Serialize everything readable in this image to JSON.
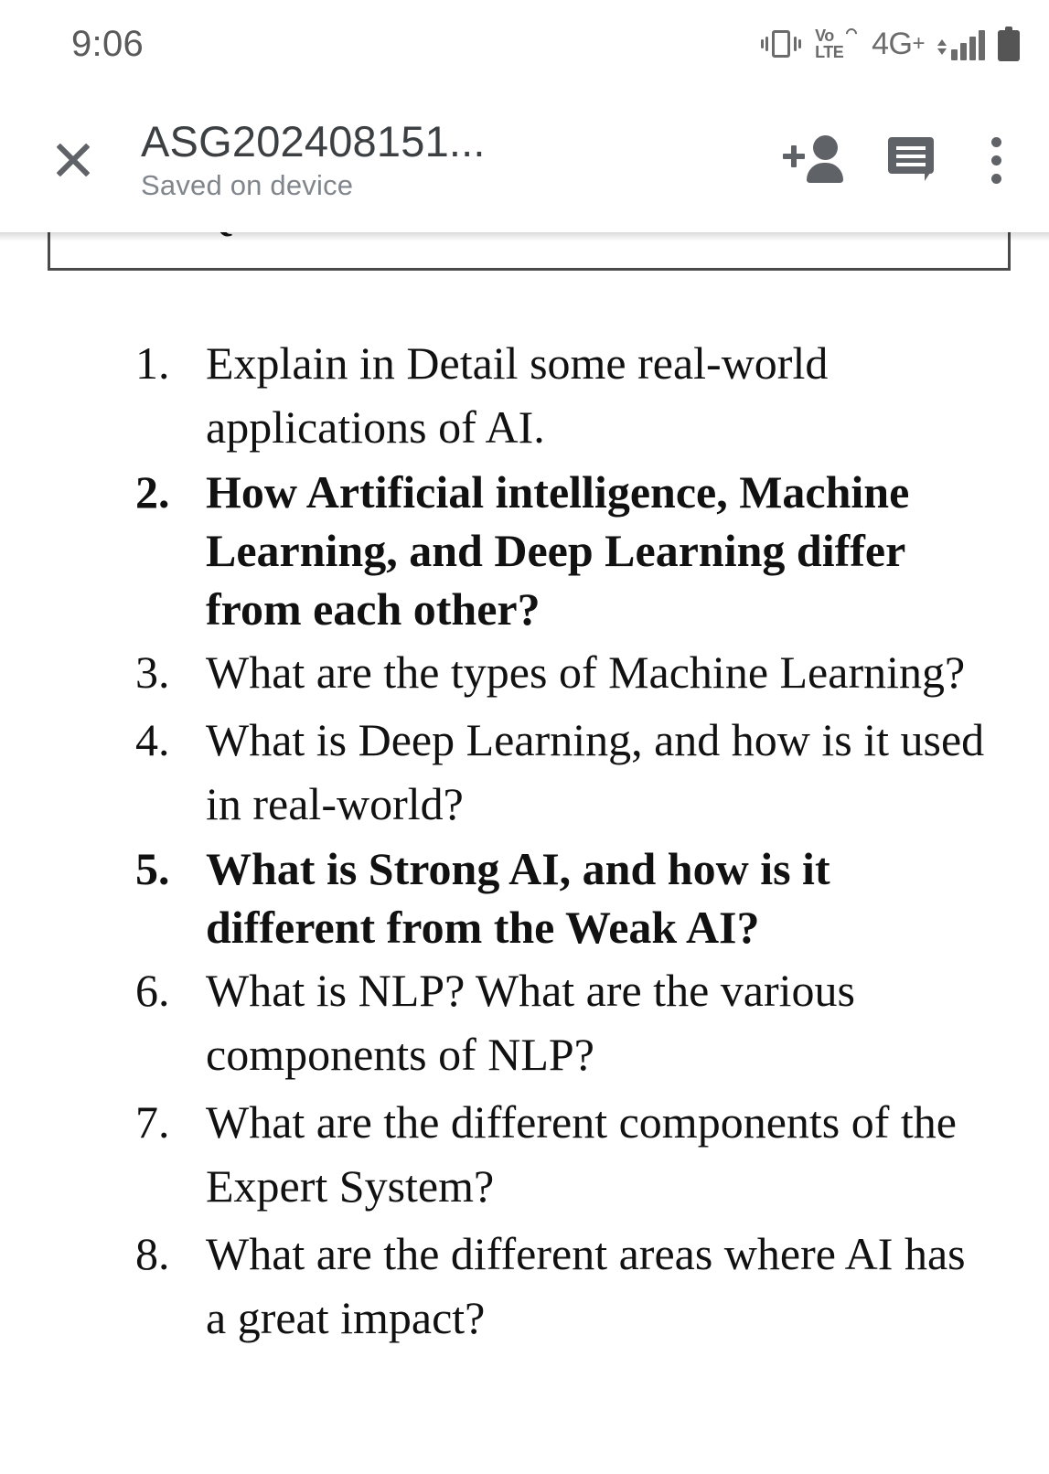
{
  "status_bar": {
    "time": "9:06",
    "network_label": "4G",
    "network_sup": "+",
    "icons": [
      "vibrate-icon",
      "volte-icon",
      "network-type-label",
      "signal-bars-icon",
      "battery-icon"
    ],
    "volte_top": "Vo",
    "volte_bottom": "LTE",
    "icon_color": "#6b6b6b"
  },
  "toolbar": {
    "close_label": "close-icon",
    "title": "ASG202408151...",
    "subtitle": "Saved on device",
    "actions": [
      {
        "name": "add-collaborator-button",
        "icon": "person-add-icon"
      },
      {
        "name": "comments-button",
        "icon": "comment-icon"
      },
      {
        "name": "overflow-menu-button",
        "icon": "more-vert-icon"
      }
    ],
    "icon_color": "#5f6368",
    "title_color": "#3c4043",
    "subtitle_color": "#80868b"
  },
  "document": {
    "table_cell_text": "Marks Questions",
    "questions": [
      {
        "number": "1.",
        "text": "Explain in Detail some real-world applications of AI.",
        "bold": false
      },
      {
        "number": "2.",
        "text": "How Artificial intelligence, Machine Learning, and Deep Learning differ from each other?",
        "bold": true
      },
      {
        "number": "3.",
        "text": "What are the types of Machine Learning?",
        "bold": false
      },
      {
        "number": "4.",
        "text": "What is Deep Learning, and how is it used in real-world?",
        "bold": false
      },
      {
        "number": "5.",
        "text": "What is Strong AI, and how is it different from the Weak AI?",
        "bold": true
      },
      {
        "number": "6.",
        "text": "What is NLP? What are the various components of NLP?",
        "bold": false
      },
      {
        "number": "7.",
        "text": "What are the different components of the Expert System?",
        "bold": false
      },
      {
        "number": "8.",
        "text": "What are the different areas where AI has a great impact?",
        "bold": false
      }
    ],
    "text_color": "#111111",
    "page_background": "#ffffff"
  }
}
